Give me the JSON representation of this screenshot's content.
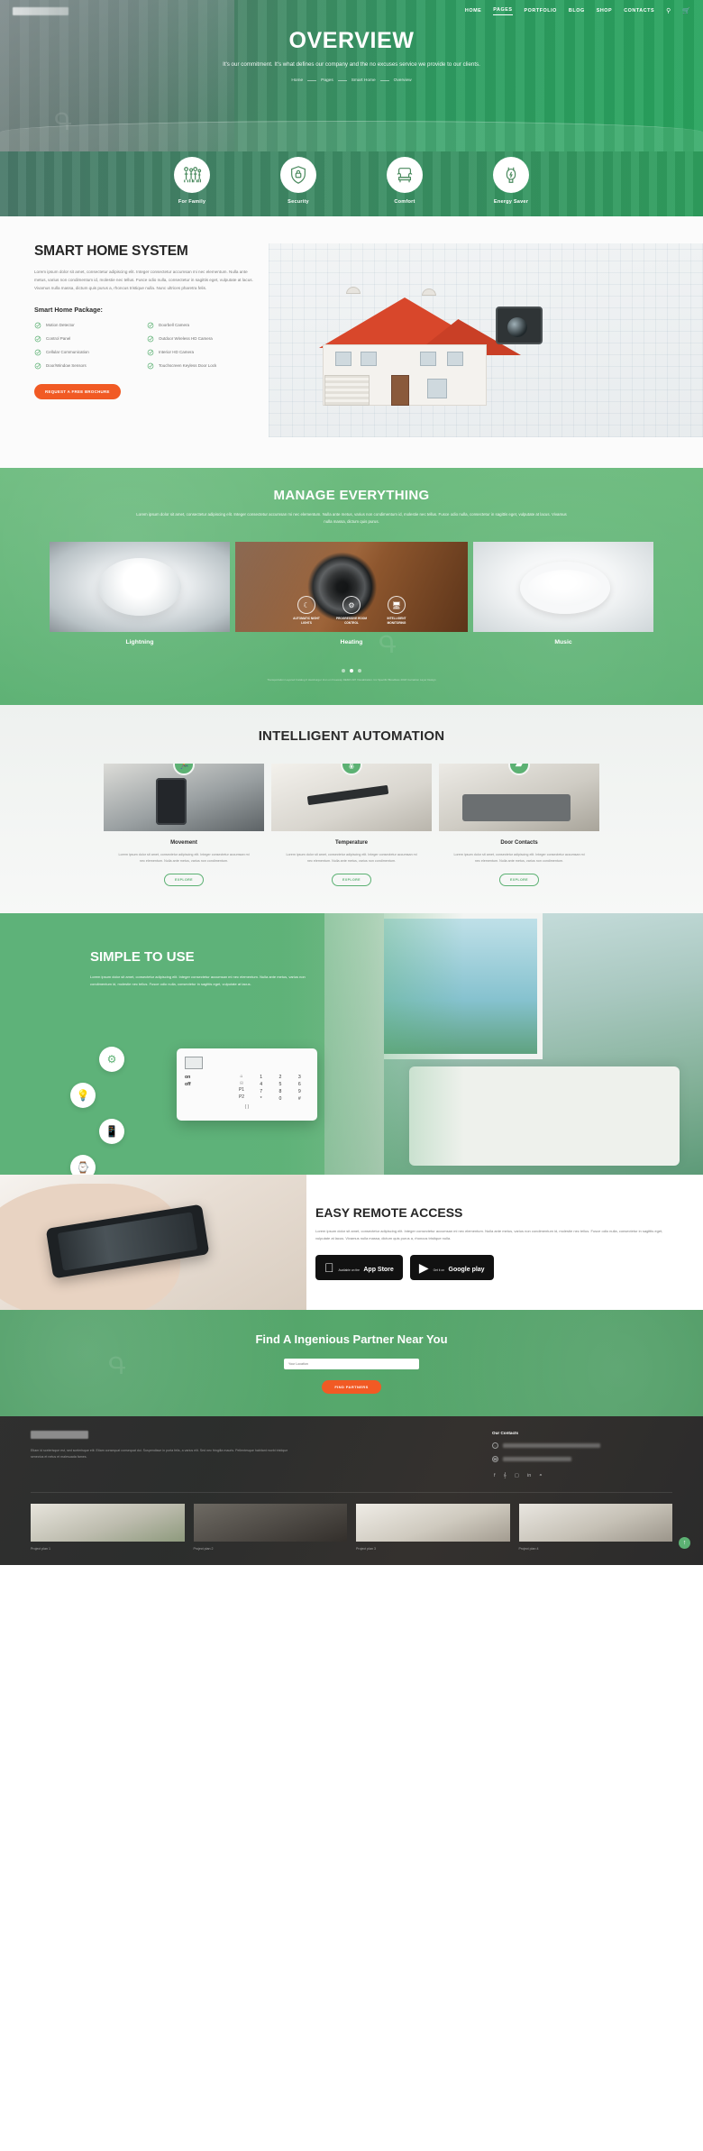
{
  "header": {
    "nav": [
      {
        "label": "HOME",
        "active": false
      },
      {
        "label": "PAGES",
        "active": true
      },
      {
        "label": "PORTFOLIO",
        "active": false
      },
      {
        "label": "BLOG",
        "active": false
      },
      {
        "label": "SHOP",
        "active": false
      },
      {
        "label": "CONTACTS",
        "active": false
      }
    ],
    "search_icon": "search-icon",
    "cart_icon": "cart-icon",
    "title": "OVERVIEW",
    "subtitle": "It's our commitment. It's what defines our company and the no excuses service we provide to our clients.",
    "breadcrumb": [
      "Home",
      "Pages",
      "Smart Home",
      "Overview"
    ]
  },
  "features": [
    {
      "label": "For Family",
      "icon": "family-icon"
    },
    {
      "label": "Security",
      "icon": "shield-lock-icon"
    },
    {
      "label": "Comfort",
      "icon": "armchair-icon"
    },
    {
      "label": "Energy Saver",
      "icon": "energy-plug-icon"
    }
  ],
  "smart_home": {
    "title": "SMART HOME SYSTEM",
    "body": "Lorem ipsum dolor sit amet, consectetur adipiscing elit. Integer consectetur accumsan mi nec elementum. Nulla ante metus, varius non condimentum id, molestie nec tellus. Fusce odio nulla, consectetur in sagittis eget, vulputate at lacus. Vivamus nulla massa, dictum quis purus a, rhoncus tristique nulla. Nunc ultrices pharetra felis.",
    "package_title": "Smart Home Package:",
    "items": [
      "Motion Detector",
      "Doorbell Camera",
      "Control Panel",
      "Outdoor Wireless HD Camera",
      "Cellular Communication",
      "Interior HD Camera",
      "Door/Window Sensors",
      "Touchscreen Keyless Door Lock"
    ],
    "cta": "REQUEST A FREE BROCHURE"
  },
  "manage": {
    "title": "MANAGE EVERYTHING",
    "body": "Lorem ipsum dolor sit amet, consectetur adipiscing elit. Integer consectetur accumsan mi nec elementum. Nulla ante metus, varius non condimentum id, molestie nec tellus. Fusce odio nulla, consectetur in sagittis eget, vulputate at lacus. Vivamus nulla massa, dictum quis purus.",
    "cards": [
      {
        "label": "Lightning"
      },
      {
        "label": "Heating"
      },
      {
        "label": "Music"
      }
    ],
    "heating_icons": [
      {
        "label": "AUTOMATIC NIGHT LIGHTS",
        "icon": "moon-icon"
      },
      {
        "label": "PROGRESSIVE ROOM CONTROL",
        "icon": "dial-icon"
      },
      {
        "label": "INTELLIGENT MONITORING",
        "icon": "monitor-icon"
      }
    ],
    "note": "Transportation Layered Catalog 0 Hamburger Icon on Freeway DEMO API Visualization. Inc Specific Bloodless 2018 Carnation Layer Design"
  },
  "automation": {
    "title": "INTELLIGENT AUTOMATION",
    "cards": [
      {
        "badge": "run-icon",
        "title": "Movement",
        "body": "Lorem ipsum dolor sit amet, consectetur adipiscing elit. Integer consectetur accumsan mi nec elementum. Nulla ante metus, varius non condimentum.",
        "cta": "EXPLORE"
      },
      {
        "badge": "thermometer-icon",
        "title": "Temperature",
        "body": "Lorem ipsum dolor sit amet, consectetur adipiscing elit. Integer consectetur accumsan mi nec elementum. Nulla ante metus, varius non condimentum.",
        "cta": "EXPLORE"
      },
      {
        "badge": "door-sensor-icon",
        "title": "Door Contacts",
        "body": "Lorem ipsum dolor sit amet, consectetur adipiscing elit. Integer consectetur accumsan mi nec elementum. Nulla ante metus, varius non condimentum.",
        "cta": "EXPLORE"
      }
    ]
  },
  "simple": {
    "title": "SIMPLE TO USE",
    "body": "Lorem ipsum dolor sit amet, consectetur adipiscing elit. Integer consectetur accumsan mi nec elementum. Nulla ante metus, varius non condimentum id, molestie nec tellus. Fusce odio nulla, consectetur in sagittis eget, vulputate at lacus.",
    "bubbles": [
      {
        "icon": "thermostat-icon"
      },
      {
        "icon": "lightbulb-icon"
      },
      {
        "icon": "smartphone-icon"
      },
      {
        "icon": "smartwatch-icon"
      }
    ],
    "keypad": {
      "on": "on",
      "off": "off",
      "p1": "P1",
      "p2": "P2",
      "keys": [
        "1",
        "2",
        "3",
        "4",
        "5",
        "6",
        "7",
        "8",
        "9",
        "*",
        "0",
        "#"
      ],
      "footer": "( )"
    }
  },
  "remote": {
    "title": "EASY REMOTE ACCESS",
    "body": "Lorem ipsum dolor sit amet, consectetur adipiscing elit. Integer consectetur accumsan mi nec elementum. Nulla ante metus, varius non condimentum id, molestie nec tellus. Fusce odio nulla, consectetur in sagittis eget, vulputate at lacus. Vivamus nulla massa, dictum quis purus a, rhoncus tristique nulla.",
    "stores": [
      {
        "small": "Available on the",
        "big": "App Store",
        "icon": "apple-icon"
      },
      {
        "small": "Get it on",
        "big": "Google play",
        "icon": "google-play-icon"
      }
    ]
  },
  "partner": {
    "title": "Find A Ingenious Partner Near You",
    "placeholder": "Your Location",
    "value": "",
    "cta": "FIND PARTNERS"
  },
  "footer": {
    "about": "Etiam id scelerisque est, sed scelerisque elit. Etiam consequat consequat dui. Suspendisse in porta felis, a varius elit. Sed nec fringilla mauris. Pellentesque habitant morbi tristique senectus et netus et malesuada fames.",
    "contacts_title": "Our Contacts",
    "socials": [
      "facebook-icon",
      "twitter-icon",
      "instagram-icon",
      "linkedin-icon",
      "rss-icon"
    ],
    "projects": [
      {
        "caption": "Project plan 1"
      },
      {
        "caption": "Project plan 2"
      },
      {
        "caption": "Project plan 3"
      },
      {
        "caption": "Project plan 4"
      }
    ],
    "to_top": "to-top-icon"
  },
  "colors": {
    "green": "#5cb173",
    "orange": "#f15a24",
    "dark": "#2b2b2b"
  }
}
